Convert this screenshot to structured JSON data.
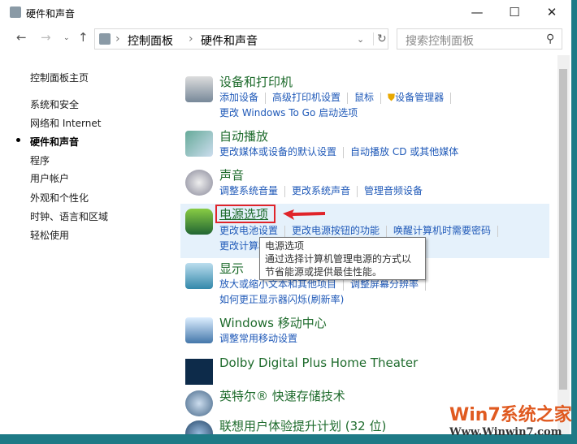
{
  "window": {
    "title": "硬件和声音"
  },
  "toolbar": {
    "breadcrumb": [
      "控制面板",
      "硬件和声音"
    ],
    "search_placeholder": "搜索控制面板"
  },
  "sidebar": {
    "items": [
      "控制面板主页",
      "系统和安全",
      "网络和 Internet",
      "硬件和声音",
      "程序",
      "用户帐户",
      "外观和个性化",
      "时钟、语言和区域",
      "轻松使用"
    ],
    "current": 3
  },
  "sections": [
    {
      "title": "设备和打印机",
      "rows": [
        [
          "添加设备",
          "高级打印机设置",
          "鼠标",
          "设备管理器"
        ],
        [
          "更改 Windows To Go 启动选项"
        ]
      ]
    },
    {
      "title": "自动播放",
      "rows": [
        [
          "更改媒体或设备的默认设置",
          "自动播放 CD 或其他媒体"
        ]
      ]
    },
    {
      "title": "声音",
      "rows": [
        [
          "调整系统音量",
          "更改系统声音",
          "管理音频设备"
        ]
      ]
    },
    {
      "title": "电源选项",
      "rows": [
        [
          "更改电池设置",
          "更改电源按钮的功能",
          "唤醒计算机时需要密码"
        ],
        [
          "更改计算机睡眠时间"
        ]
      ]
    },
    {
      "title": "显示",
      "rows": [
        [
          "放大或缩小文本和其他项目",
          "调整屏幕分辨率"
        ],
        [
          "如何更正显示器闪烁(刷新率)"
        ]
      ]
    },
    {
      "title": "Windows 移动中心",
      "rows": [
        [
          "调整常用移动设置"
        ]
      ]
    },
    {
      "title": "Dolby Digital Plus Home Theater",
      "rows": []
    },
    {
      "title": "英特尔® 快速存储技术",
      "rows": []
    },
    {
      "title": "联想用户体验提升计划 (32 位)",
      "rows": []
    }
  ],
  "tooltip": {
    "title": "电源选项",
    "text": "通过选择计算机管理电源的方式以节省能源或提供最佳性能。"
  },
  "watermark": {
    "brand": "Win7系统之家",
    "url": "Www.Winwin7.com"
  }
}
